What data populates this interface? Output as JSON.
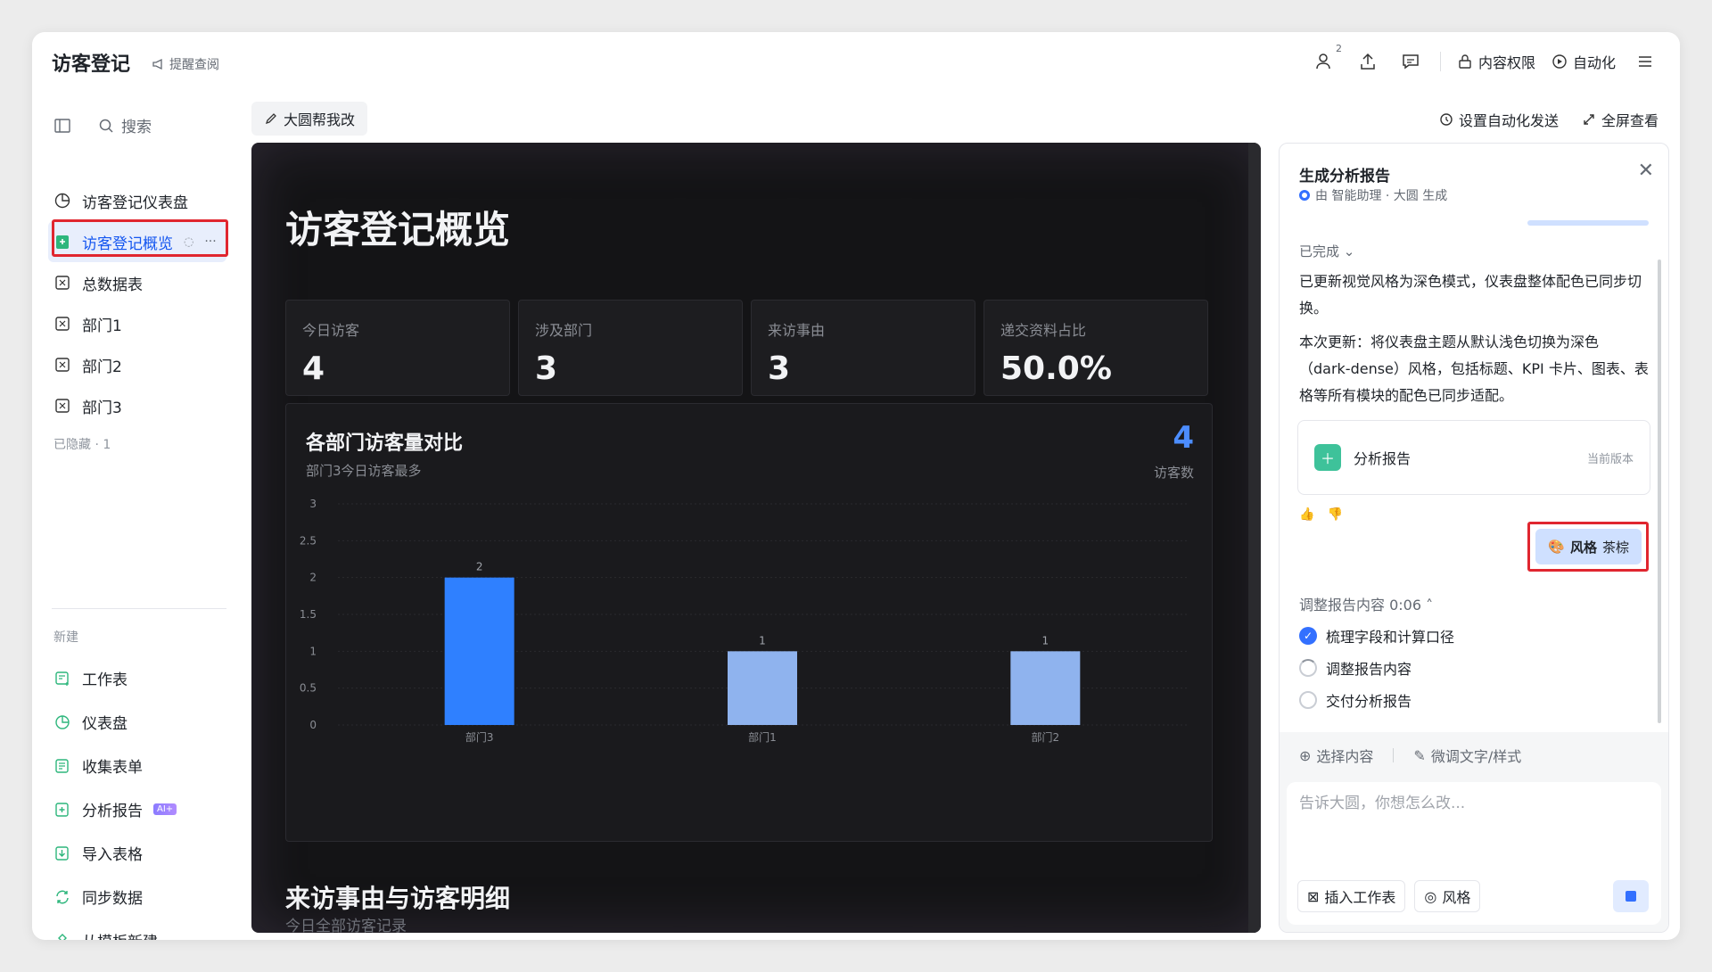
{
  "header": {
    "title": "访客登记",
    "reminder": "提醒查阅",
    "collab_count": "2",
    "permission": "内容权限",
    "automation": "自动化"
  },
  "sidebar": {
    "search": "搜索",
    "items": [
      {
        "label": "访客登记仪表盘",
        "icon": "dashboard-icon"
      },
      {
        "label": "访客登记概览",
        "icon": "report-icon",
        "active": true
      },
      {
        "label": "总数据表",
        "icon": "sheet-icon"
      },
      {
        "label": "部门1",
        "icon": "sheet-icon"
      },
      {
        "label": "部门2",
        "icon": "sheet-icon"
      },
      {
        "label": "部门3",
        "icon": "sheet-icon"
      }
    ],
    "hidden": "已隐藏 · 1",
    "new_label": "新建",
    "new_items": [
      {
        "label": "工作表",
        "icon": "worksheet-icon"
      },
      {
        "label": "仪表盘",
        "icon": "dashboard-icon"
      },
      {
        "label": "收集表单",
        "icon": "form-icon"
      },
      {
        "label": "分析报告",
        "icon": "report-icon",
        "badge": "AI+"
      },
      {
        "label": "导入表格",
        "icon": "import-icon"
      },
      {
        "label": "同步数据",
        "icon": "sync-icon"
      },
      {
        "label": "从模板新建",
        "icon": "template-icon"
      }
    ]
  },
  "toolbar": {
    "edit_button": "大圆帮我改",
    "auto_send": "设置自动化发送",
    "fullscreen": "全屏查看"
  },
  "dashboard": {
    "title": "访客登记概览",
    "kpis": [
      {
        "label": "今日访客",
        "value": "4"
      },
      {
        "label": "涉及部门",
        "value": "3"
      },
      {
        "label": "来访事由",
        "value": "3"
      },
      {
        "label": "递交资料占比",
        "value": "50.0%"
      }
    ],
    "chart_card": {
      "title": "各部门访客量对比",
      "subtitle": "部门3今日访客最多",
      "metric": "4",
      "metric_label": "访客数"
    },
    "section_title": "来访事由与访客明细",
    "section_subtitle": "今日全部访客记录"
  },
  "chart_data": {
    "type": "bar",
    "categories": [
      "部门3",
      "部门1",
      "部门2"
    ],
    "values": [
      2,
      1,
      1
    ],
    "colors": [
      "#2f80ff",
      "#8fb3ee",
      "#8fb3ee"
    ],
    "ylim": [
      0,
      3
    ],
    "yticks": [
      "0",
      "0.5",
      "1",
      "1.5",
      "2",
      "2.5",
      "3"
    ],
    "title": "各部门访客量对比",
    "xlabel": "",
    "ylabel": ""
  },
  "panel": {
    "title": "生成分析报告",
    "by": "由 智能助理 · 大圆 生成",
    "done": "已完成 ⌄",
    "msg1": "已更新视觉风格为深色模式，仪表盘整体配色已同步切换。",
    "msg2": "本次更新：将仪表盘主题从默认浅色切换为深色（dark-dense）风格，包括标题、KPI 卡片、图表、表格等所有模块的配色已同步适配。",
    "report_name": "分析报告",
    "report_version": "当前版本",
    "style_label": "风格",
    "style_value": "茶棕",
    "adjust_head": "调整报告内容 0:06 ˄",
    "steps": [
      {
        "label": "梳理字段和计算口径",
        "state": "done"
      },
      {
        "label": "调整报告内容",
        "state": "loading"
      },
      {
        "label": "交付分析报告",
        "state": "todo"
      }
    ],
    "select_content": "选择内容",
    "fine_tune": "微调文字/样式",
    "input_placeholder": "告诉大圆，你想怎么改...",
    "insert_sheet": "插入工作表",
    "style_btn": "风格"
  }
}
